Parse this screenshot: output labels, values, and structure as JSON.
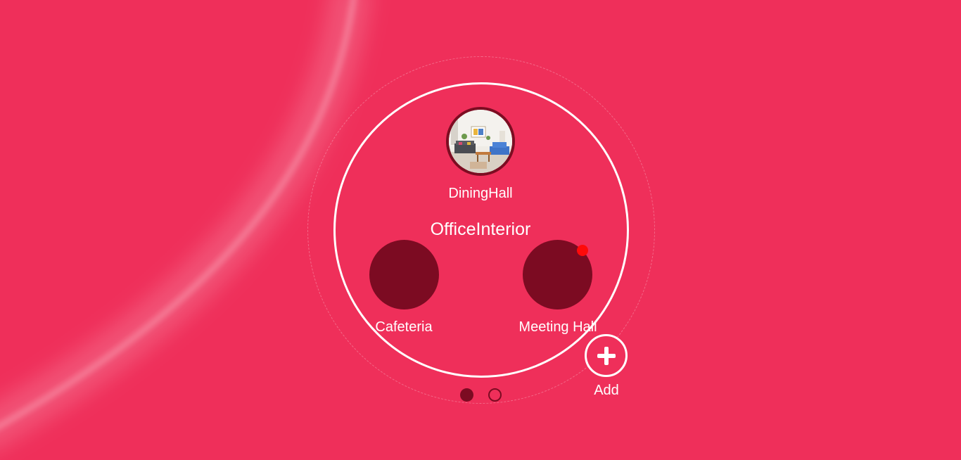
{
  "hub": {
    "title": "OfficeInterior",
    "rooms": [
      {
        "label": "DiningHall",
        "has_photo": true
      },
      {
        "label": "Cafeteria",
        "has_photo": false
      },
      {
        "label": "Meeting Hall",
        "has_photo": false,
        "has_notification": true
      }
    ],
    "add_label": "Add"
  },
  "pager": {
    "pages": 2,
    "current": 1
  },
  "icons": {
    "add": "plus-icon",
    "notification": "notification-dot-icon"
  },
  "colors": {
    "background": "#ef2f5a",
    "room_fill": "#7c0b22",
    "ring": "#ffffff",
    "notification": "#ff0a0a"
  }
}
